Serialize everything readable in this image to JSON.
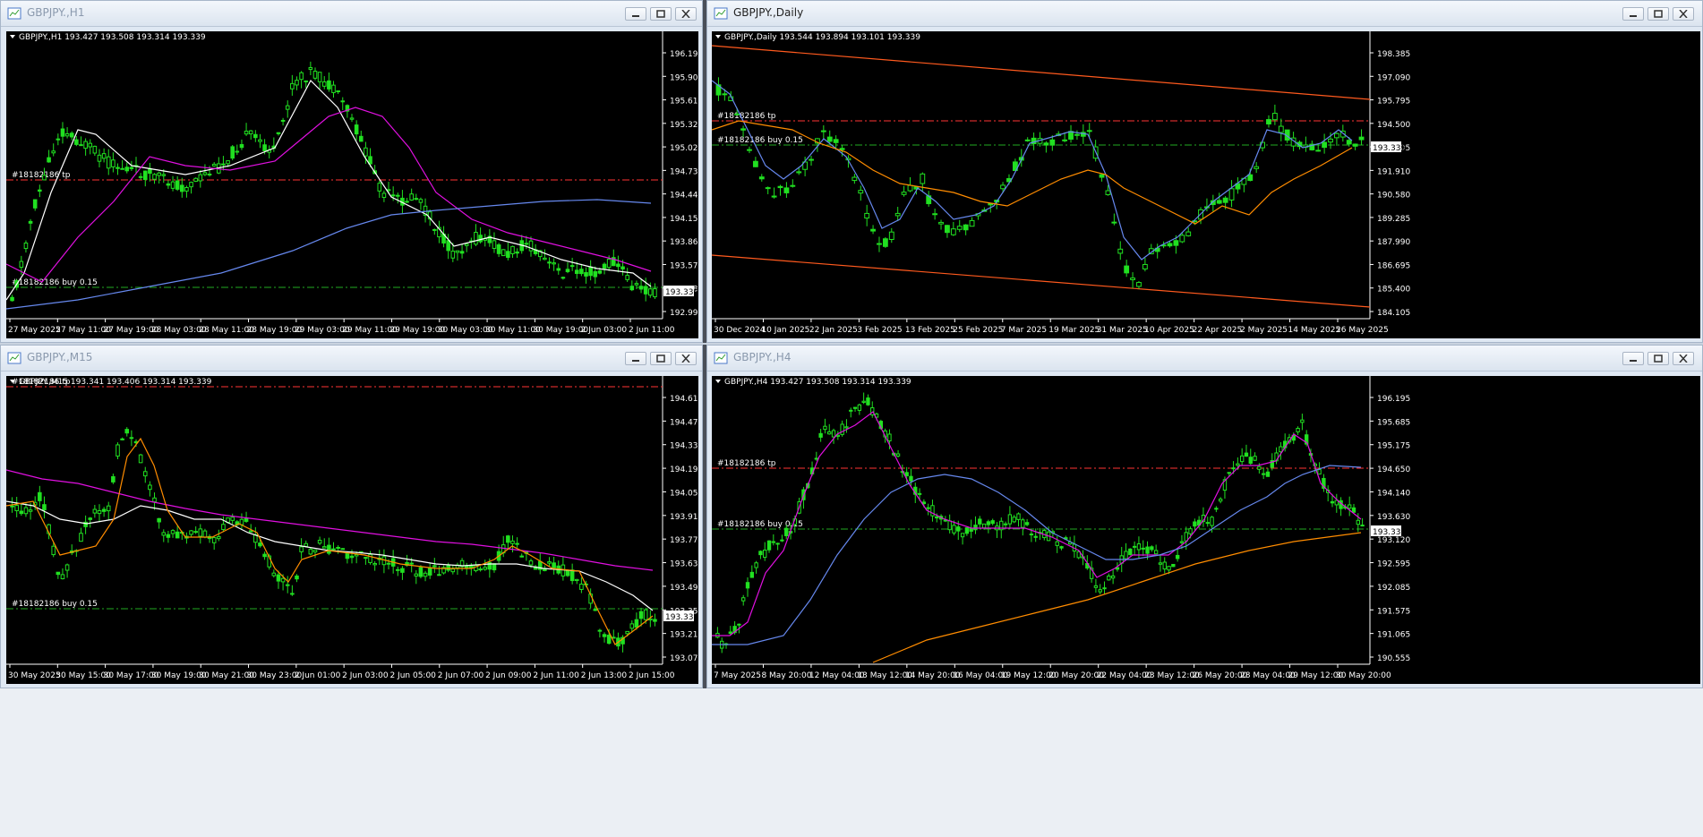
{
  "colors": {
    "bull": "#21e021",
    "bear": "#21e021",
    "tp_line": "#ff3333",
    "buy_line": "#22aa22",
    "axis_text": "#ffffff",
    "white_ma": "#ffffff",
    "magenta_ma": "#e010e0",
    "blue_ma": "#6688ee",
    "orange_ma": "#ff8c00",
    "channel": "#ff5a1e"
  },
  "windows": [
    {
      "id": "h1",
      "title": "GBPJPY.,H1",
      "header": "GBPJPY.,H1  193.427 193.508 193.314 193.339",
      "price_tag": "193.339",
      "tp_label": "#18182186 tp",
      "buy_label": "#18182186 buy 0.15",
      "y_ticks": [
        "196.190",
        "195.900",
        "195.610",
        "195.320",
        "195.025",
        "194.735",
        "194.445",
        "194.155",
        "193.865",
        "193.570",
        "193.280",
        "192.990"
      ],
      "x_ticks": [
        "27 May 2025",
        "27 May 11:00",
        "27 May 19:00",
        "28 May 03:00",
        "28 May 11:00",
        "28 May 19:00",
        "29 May 03:00",
        "29 May 11:00",
        "29 May 19:00",
        "30 May 03:00",
        "30 May 11:00",
        "30 May 19:00",
        "2 Jun 03:00",
        "2 Jun 11:00"
      ]
    },
    {
      "id": "daily",
      "title": "GBPJPY.,Daily",
      "header": "GBPJPY.,Daily  193.544 193.894 193.101 193.339",
      "price_tag": "193.339",
      "tp_label": "#18182186 tp",
      "buy_label": "#18182186 buy 0.15",
      "y_ticks": [
        "198.385",
        "197.090",
        "195.795",
        "194.500",
        "193.205",
        "191.910",
        "190.580",
        "189.285",
        "187.990",
        "186.695",
        "185.400",
        "184.105"
      ],
      "x_ticks": [
        "30 Dec 2024",
        "10 Jan 2025",
        "22 Jan 2025",
        "3 Feb 2025",
        "13 Feb 2025",
        "25 Feb 2025",
        "7 Mar 2025",
        "19 Mar 2025",
        "31 Mar 2025",
        "10 Apr 2025",
        "22 Apr 2025",
        "2 May 2025",
        "14 May 2025",
        "26 May 2025"
      ]
    },
    {
      "id": "m15",
      "title": "GBPJPY.,M15",
      "header": "GBPJPY.,M15  193.341 193.406 193.314 193.339",
      "price_tag": "193.339",
      "tp_label": "#18182186 tp",
      "buy_label": "#18182186 buy 0.15",
      "y_ticks": [
        "194.610",
        "194.470",
        "194.330",
        "194.190",
        "194.050",
        "193.910",
        "193.770",
        "193.630",
        "193.490",
        "193.350",
        "193.210",
        "193.070"
      ],
      "x_ticks": [
        "30 May 2025",
        "30 May 15:00",
        "30 May 17:00",
        "30 May 19:00",
        "30 May 21:00",
        "30 May 23:00",
        "2 Jun 01:00",
        "2 Jun 03:00",
        "2 Jun 05:00",
        "2 Jun 07:00",
        "2 Jun 09:00",
        "2 Jun 11:00",
        "2 Jun 13:00",
        "2 Jun 15:00"
      ]
    },
    {
      "id": "h4",
      "title": "GBPJPY.,H4",
      "header": "GBPJPY.,H4  193.427 193.508 193.314 193.339",
      "price_tag": "193.339",
      "tp_label": "#18182186 tp",
      "buy_label": "#18182186 buy 0.15",
      "y_ticks": [
        "196.195",
        "195.685",
        "195.175",
        "194.650",
        "194.140",
        "193.630",
        "193.120",
        "192.595",
        "192.085",
        "191.575",
        "191.065",
        "190.555"
      ],
      "x_ticks": [
        "7 May 2025",
        "8 May 20:00",
        "12 May 04:00",
        "13 May 12:00",
        "14 May 20:00",
        "16 May 04:00",
        "19 May 12:00",
        "20 May 20:00",
        "22 May 04:00",
        "23 May 12:00",
        "26 May 20:00",
        "28 May 04:00",
        "29 May 12:00",
        "30 May 20:00"
      ]
    }
  ]
}
